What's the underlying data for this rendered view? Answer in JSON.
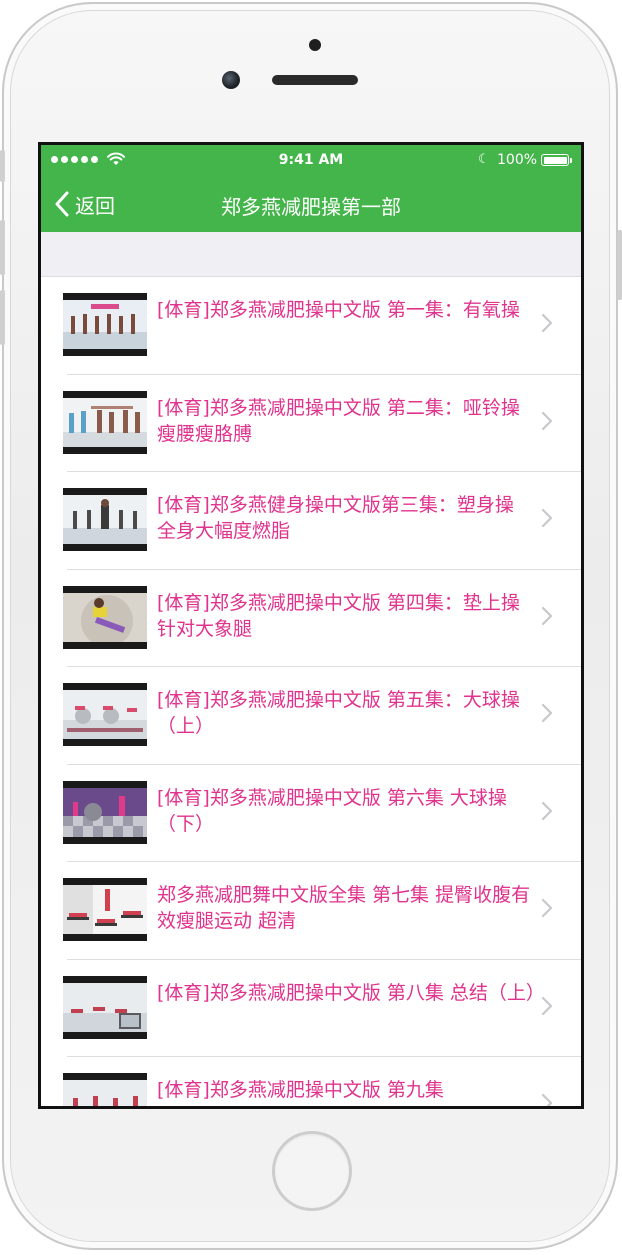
{
  "status_bar": {
    "time": "9:41 AM",
    "battery": "100%"
  },
  "nav": {
    "back_label": "返回",
    "title": "郑多燕减肥操第一部"
  },
  "colors": {
    "nav_green": "#44b54a",
    "title_pink": "#e0338d",
    "chevron_gray": "#c7c7cc",
    "background": "#efeff4"
  },
  "videos": [
    {
      "title": "[体育]郑多燕减肥操中文版 第一集：有氧操"
    },
    {
      "title": "[体育]郑多燕减肥操中文版 第二集：哑铃操 瘦腰瘦胳膊"
    },
    {
      "title": "[体育]郑多燕健身操中文版第三集：塑身操 全身大幅度燃脂"
    },
    {
      "title": "[体育]郑多燕减肥操中文版 第四集：垫上操 针对大象腿"
    },
    {
      "title": "[体育]郑多燕减肥操中文版 第五集：大球操（上）"
    },
    {
      "title": "[体育]郑多燕减肥操中文版 第六集 大球操（下）"
    },
    {
      "title": "郑多燕减肥舞中文版全集 第七集 提臀收腹有效瘦腿运动 超清"
    },
    {
      "title": "[体育]郑多燕减肥操中文版 第八集 总结（上）"
    },
    {
      "title": "[体育]郑多燕减肥操中文版 第九集"
    }
  ]
}
